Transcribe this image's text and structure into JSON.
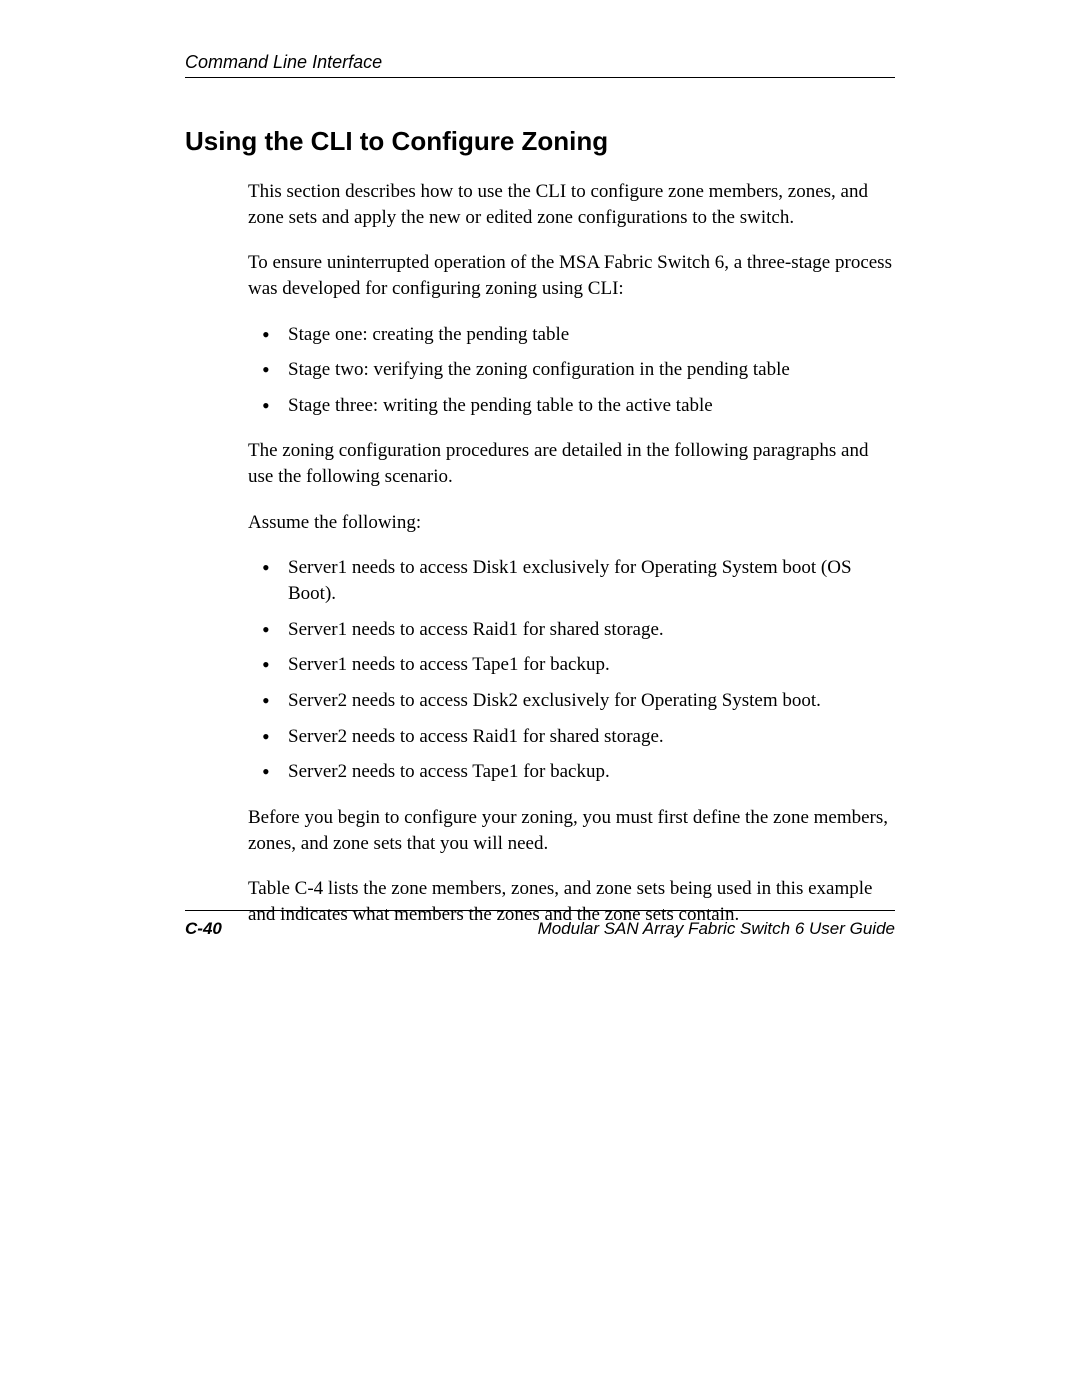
{
  "header": {
    "section": "Command Line Interface"
  },
  "heading": "Using the CLI to Configure Zoning",
  "paragraphs": {
    "intro1": "This section describes how to use the CLI to configure zone members, zones, and zone sets and apply the new or edited zone configurations to the switch.",
    "intro2": "To ensure uninterrupted operation of the MSA Fabric Switch 6, a three-stage process was developed for configuring zoning using CLI:",
    "after_stages": "The zoning configuration procedures are detailed in the following paragraphs and use the following scenario.",
    "assume": "Assume the following:",
    "before_begin": "Before you begin to configure your zoning, you must first define the zone members, zones, and zone sets that you will need.",
    "table_ref": "Table C-4 lists the zone members, zones, and zone sets being used in this example and indicates what members the zones and the zone sets contain."
  },
  "stages": [
    "Stage one: creating the pending table",
    "Stage two: verifying the zoning configuration in the pending table",
    "Stage three: writing the pending table to the active table"
  ],
  "assumptions": [
    "Server1 needs to access Disk1 exclusively for Operating System boot (OS Boot).",
    "Server1 needs to access Raid1 for shared storage.",
    "Server1 needs to access Tape1 for backup.",
    "Server2 needs to access Disk2 exclusively for Operating System boot.",
    "Server2 needs to access Raid1 for shared storage.",
    "Server2 needs to access Tape1 for backup."
  ],
  "footer": {
    "page_number": "C-40",
    "doc_title": "Modular SAN Array Fabric Switch 6 User Guide"
  }
}
